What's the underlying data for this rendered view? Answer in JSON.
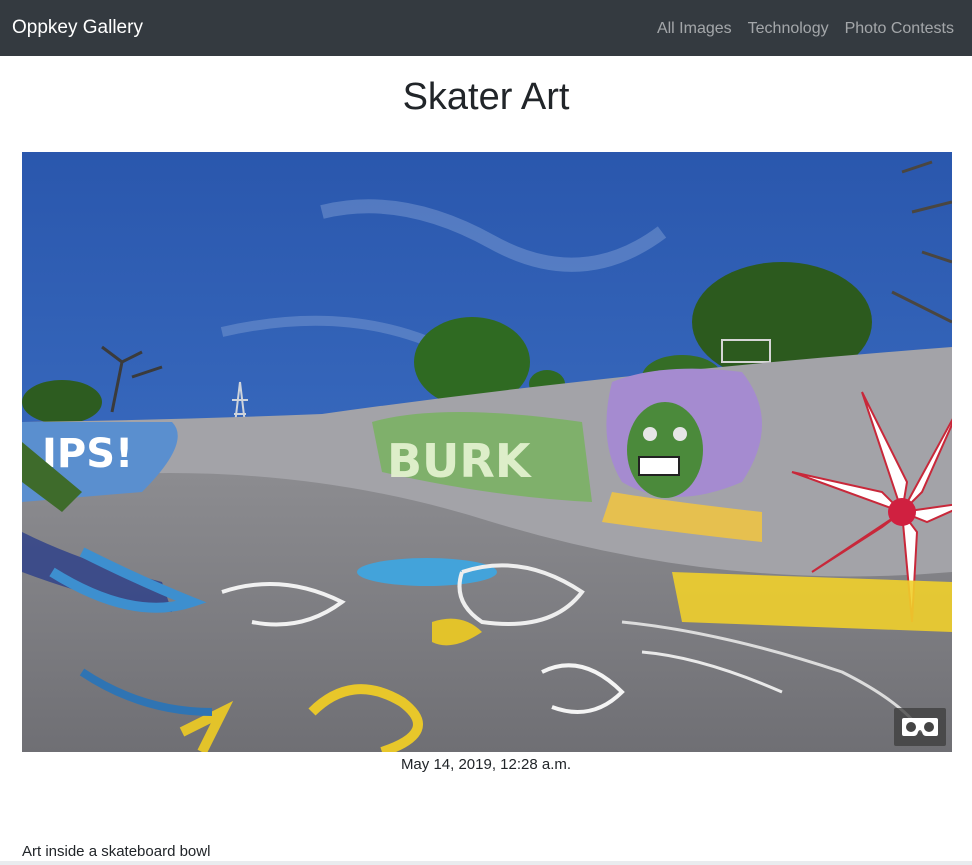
{
  "navbar": {
    "brand": "Oppkey Gallery",
    "links": [
      "All Images",
      "Technology",
      "Photo Contests"
    ]
  },
  "page": {
    "title": "Skater Art",
    "date": "May 14, 2019, 12:28 a.m.",
    "description": "Art inside a skateboard bowl"
  },
  "image": {
    "subject": "360 panorama of a graffiti-covered skateboard bowl under blue sky",
    "vr_icon": "vr-goggles-icon"
  },
  "colors": {
    "navbar_bg": "#343a40",
    "brand": "#ffffff",
    "nav_link": "rgba(255,255,255,0.55)",
    "sky": "#2f5fb4",
    "concrete": "#8a8a8e"
  }
}
